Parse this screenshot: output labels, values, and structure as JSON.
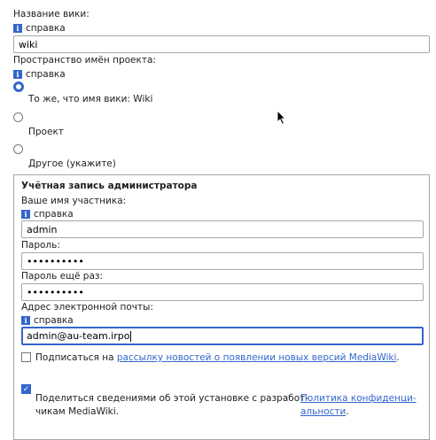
{
  "wiki_name": {
    "label": "Название вики:",
    "help": "справка",
    "value": "wiki"
  },
  "namespace": {
    "label": "Пространство имён проекта:",
    "help": "справка",
    "options": [
      {
        "label": "То же, что имя вики: Wiki",
        "checked": true
      },
      {
        "label": "Проект",
        "checked": false
      },
      {
        "label": "Другое (укажите)",
        "checked": false
      }
    ]
  },
  "admin_account": {
    "legend": "Учётная запись администратора",
    "username_label": "Ваше имя участника:",
    "username_help": "справка",
    "username_value": "admin",
    "password_label": "Пароль:",
    "password_value": "••••••••••",
    "password2_label": "Пароль ещё раз:",
    "password2_value": "••••••••••",
    "email_label": "Адрес электронной почты:",
    "email_help": "справка",
    "email_value": "admin@au-team.irpo",
    "subscribe_prefix": "Подписаться на ",
    "subscribe_link": "рассылку новостей о появлении новых версий MediaWiki",
    "subscribe_suffix": ".",
    "subscribe_checked": false,
    "share_text_1": "Поделиться сведениями об этой установке с разработ-",
    "share_text_2": "чикам MediaWiki.",
    "share_link_1": "Политика конфиденци-",
    "share_link_2": "альности",
    "share_suffix": ".",
    "share_checked": true
  },
  "icons": {
    "help": "info-icon",
    "pointer": "mouse-cursor-icon"
  },
  "colors": {
    "accent": "#3366cc",
    "border": "#a2a9b1",
    "text": "#202122"
  }
}
